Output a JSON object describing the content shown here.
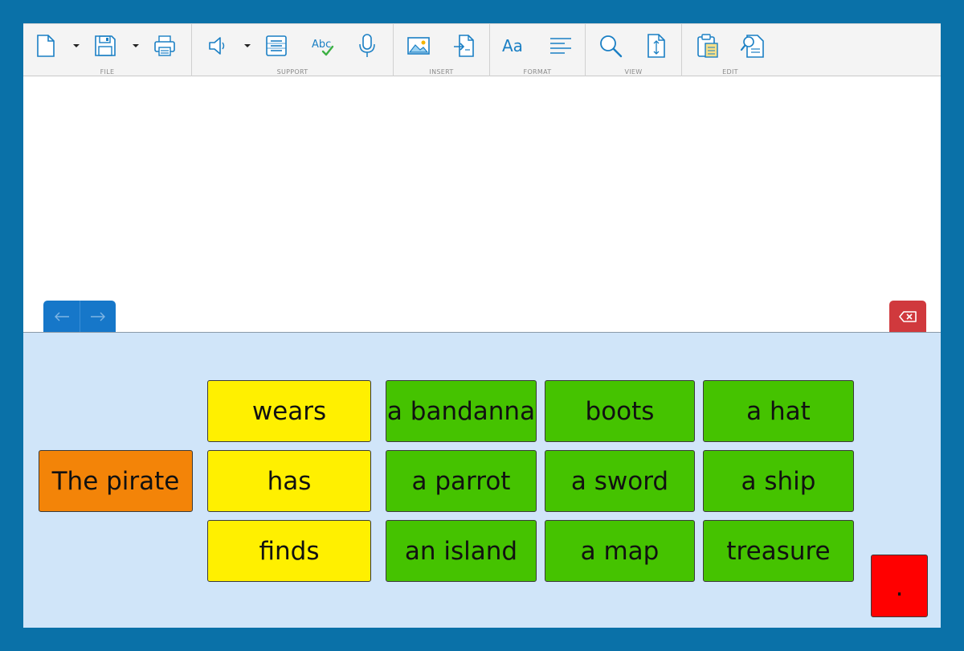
{
  "ribbon": {
    "groups": {
      "file": "FILE",
      "support": "SUPPORT",
      "insert": "INSERT",
      "format": "FORMAT",
      "view": "VIEW",
      "edit": "EDIT"
    },
    "icons": {
      "file": [
        "new-document-icon",
        "dropdown-arrow-icon",
        "save-icon",
        "dropdown-arrow-icon",
        "print-icon"
      ],
      "support": [
        "speaker-icon",
        "dropdown-arrow-icon",
        "word-list-icon",
        "spellcheck-icon",
        "microphone-icon"
      ],
      "insert": [
        "image-icon",
        "insert-document-icon"
      ],
      "format": [
        "font-icon",
        "align-left-icon"
      ],
      "view": [
        "zoom-icon",
        "page-size-icon"
      ],
      "edit": [
        "paste-icon",
        "find-replace-icon"
      ]
    },
    "format_font_label": "Aa",
    "spell_label": "Abc"
  },
  "document": {
    "text": ""
  },
  "nav": {
    "back": "←",
    "forward": "→"
  },
  "grid": {
    "subject": "The pirate",
    "verbs": [
      "wears",
      "has",
      "finds"
    ],
    "objects": [
      [
        "a bandanna",
        "boots",
        "a hat"
      ],
      [
        "a parrot",
        "a sword",
        "a ship"
      ],
      [
        "an island",
        "a map",
        "treasure"
      ]
    ],
    "punctuation": "."
  },
  "colors": {
    "frame": "#0a71a8",
    "subject": "#f38408",
    "verb": "#fff000",
    "object": "#45c300",
    "punctuation": "#ff0000",
    "grid_background": "#d0e5f9",
    "nav_pill": "#1677c9",
    "backspace": "#d0393d"
  }
}
